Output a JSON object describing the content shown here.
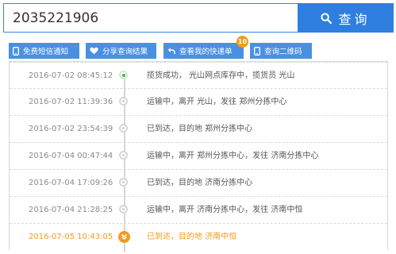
{
  "search": {
    "value": "2035221906",
    "button_label": "查询",
    "icon": "search-icon"
  },
  "actions": [
    {
      "label": "免费短信通知",
      "icon": "phone-icon"
    },
    {
      "label": "分享查询结果",
      "icon": "heart-icon"
    },
    {
      "label": "查看我的快递单",
      "icon": "return-arrow-icon",
      "badge": "10"
    },
    {
      "label": "查询二维码",
      "icon": "phone-icon"
    }
  ],
  "timeline": [
    {
      "time": "2016-07-02 08:45:12",
      "desc": "揽货成功， 光山网点库存中，揽货员 光山"
    },
    {
      "time": "2016-07-02 11:39:36",
      "desc": "运输中，离开 光山，发往 郑州分拣中心"
    },
    {
      "time": "2016-07-02 23:54:39",
      "desc": "已到达，目的地 郑州分拣中心"
    },
    {
      "time": "2016-07-04 00:47:44",
      "desc": "运输中，离开 郑州分拣中心，发往 济南分拣中心"
    },
    {
      "time": "2016-07-04 17:09:26",
      "desc": "已到达，目的地 济南分拣中心"
    },
    {
      "time": "2016-07-04 21:28:25",
      "desc": "运输中，离开 济南分拣中心，发往 济南中恒"
    },
    {
      "time": "2016-07-05 10:43:05",
      "desc": "已到达，目的地 济南中恒"
    }
  ],
  "colors": {
    "primary": "#2f7fe0",
    "action": "#4a90e2",
    "highlight": "#f39a1e",
    "start_dot": "#4caf50"
  }
}
